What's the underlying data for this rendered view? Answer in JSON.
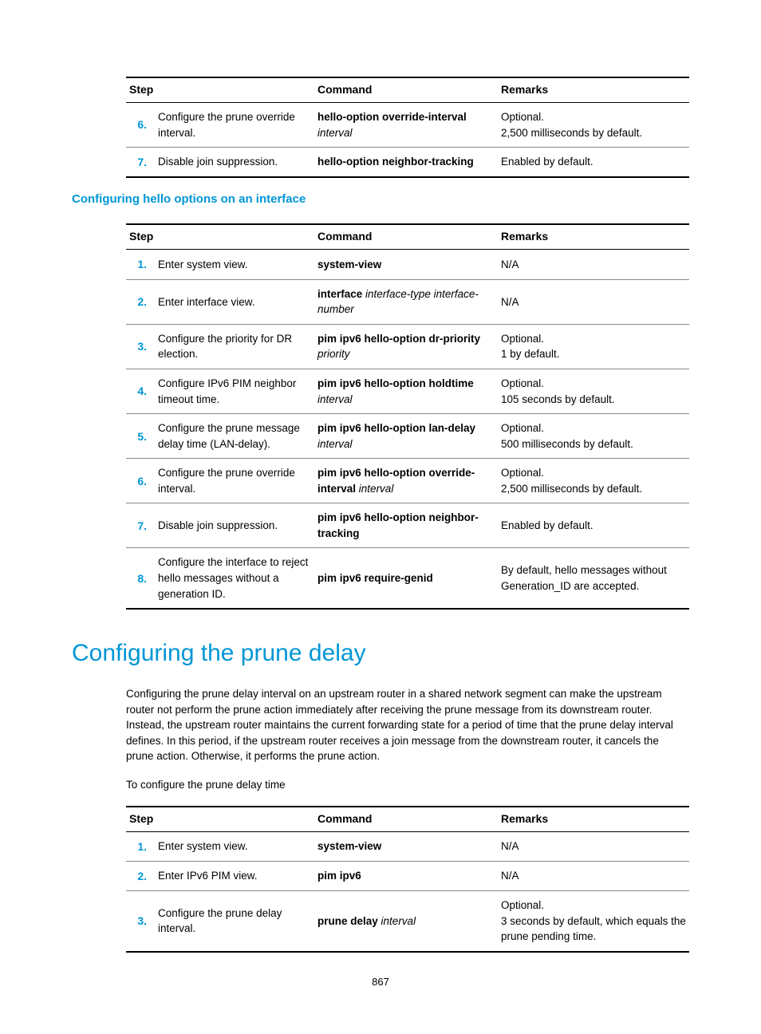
{
  "pageNumber": "867",
  "headers": {
    "step": "Step",
    "command": "Command",
    "remarks": "Remarks"
  },
  "table1": {
    "rows": [
      {
        "num": "6.",
        "desc": "Configure the prune override interval.",
        "cmd_bold": "hello-option override-interval",
        "cmd_ital": "interval",
        "rem1": "Optional.",
        "rem2": "2,500 milliseconds by default."
      },
      {
        "num": "7.",
        "desc": "Disable join suppression.",
        "cmd_bold": "hello-option neighbor-tracking",
        "cmd_ital": "",
        "rem1": "Enabled by default.",
        "rem2": ""
      }
    ]
  },
  "subhead1": "Configuring hello options on an interface",
  "table2": {
    "rows": [
      {
        "num": "1.",
        "desc": "Enter system view.",
        "cmd_bold": "system-view",
        "cmd_ital": "",
        "rem1": "N/A",
        "rem2": ""
      },
      {
        "num": "2.",
        "desc": "Enter interface view.",
        "cmd_bold": "interface",
        "cmd_ital": "interface-type interface-number",
        "rem1": "N/A",
        "rem2": ""
      },
      {
        "num": "3.",
        "desc": "Configure the priority for DR election.",
        "cmd_bold": "pim ipv6 hello-option dr-priority",
        "cmd_ital": "priority",
        "rem1": "Optional.",
        "rem2": "1 by default."
      },
      {
        "num": "4.",
        "desc": "Configure IPv6 PIM neighbor timeout time.",
        "cmd_bold": "pim ipv6 hello-option holdtime",
        "cmd_ital": "interval",
        "rem1": "Optional.",
        "rem2": "105 seconds by default."
      },
      {
        "num": "5.",
        "desc": "Configure the prune message delay time (LAN-delay).",
        "cmd_bold": "pim ipv6 hello-option lan-delay",
        "cmd_ital": "interval",
        "rem1": "Optional.",
        "rem2": "500 milliseconds by default."
      },
      {
        "num": "6.",
        "desc": "Configure the prune override interval.",
        "cmd_bold": "pim ipv6 hello-option override-interval",
        "cmd_ital": "interval",
        "rem1": "Optional.",
        "rem2": "2,500 milliseconds by default."
      },
      {
        "num": "7.",
        "desc": "Disable join suppression.",
        "cmd_bold": "pim ipv6 hello-option neighbor-tracking",
        "cmd_ital": "",
        "rem1": "Enabled by default.",
        "rem2": ""
      },
      {
        "num": "8.",
        "desc": "Configure the interface to reject hello messages without a generation ID.",
        "cmd_bold": "pim ipv6 require-genid",
        "cmd_ital": "",
        "rem1": "By default, hello messages without Generation_ID are accepted.",
        "rem2": ""
      }
    ]
  },
  "h1": "Configuring the prune delay",
  "para1": "Configuring the prune delay interval on an upstream router in a shared network segment can make the upstream router not perform the prune action immediately after receiving the prune message from its downstream router. Instead, the upstream router maintains the current forwarding state for a period of time that the prune delay interval defines. In this period, if the upstream router receives a join message from the downstream router, it cancels the prune action. Otherwise, it performs the prune action.",
  "para2": "To configure the prune delay time",
  "table3": {
    "rows": [
      {
        "num": "1.",
        "desc": "Enter system view.",
        "cmd_bold": "system-view",
        "cmd_ital": "",
        "rem1": "N/A",
        "rem2": ""
      },
      {
        "num": "2.",
        "desc": "Enter IPv6 PIM view.",
        "cmd_bold": "pim ipv6",
        "cmd_ital": "",
        "rem1": "N/A",
        "rem2": ""
      },
      {
        "num": "3.",
        "desc": "Configure the prune delay interval.",
        "cmd_bold": "prune delay",
        "cmd_ital": "interval",
        "rem1": "Optional.",
        "rem2": "3 seconds by default, which equals the prune pending time."
      }
    ]
  }
}
